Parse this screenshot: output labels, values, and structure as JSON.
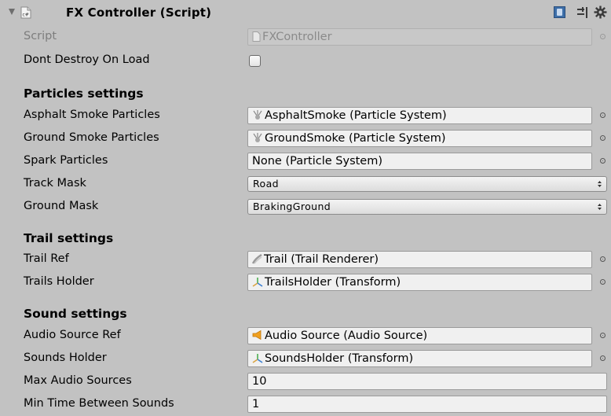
{
  "header": {
    "title": "FX Controller (Script)",
    "script_icon_text": "c#"
  },
  "fields": {
    "script": {
      "label": "Script",
      "value": "FXController"
    },
    "dont_destroy": {
      "label": "Dont Destroy On Load",
      "checked": false
    }
  },
  "particles": {
    "section_title": "Particles settings",
    "asphalt": {
      "label": "Asphalt Smoke Particles",
      "value": "AsphaltSmoke (Particle System)",
      "icon": "particle-system-icon"
    },
    "ground": {
      "label": "Ground Smoke Particles",
      "value": "GroundSmoke (Particle System)",
      "icon": "particle-system-icon"
    },
    "spark": {
      "label": "Spark Particles",
      "value": "None (Particle System)"
    },
    "track_mask": {
      "label": "Track Mask",
      "value": "Road"
    },
    "ground_mask": {
      "label": "Ground Mask",
      "value": "BrakingGround"
    }
  },
  "trail": {
    "section_title": "Trail settings",
    "trail_ref": {
      "label": "Trail Ref",
      "value": "Trail (Trail Renderer)",
      "icon": "trail-renderer-icon"
    },
    "trails_holder": {
      "label": "Trails Holder",
      "value": "TrailsHolder (Transform)",
      "icon": "transform-icon"
    }
  },
  "sound": {
    "section_title": "Sound settings",
    "audio_source_ref": {
      "label": "Audio Source Ref",
      "value": "Audio Source (Audio Source)",
      "icon": "audio-source-icon"
    },
    "sounds_holder": {
      "label": "Sounds Holder",
      "value": "SoundsHolder (Transform)",
      "icon": "transform-icon"
    },
    "max_audio_sources": {
      "label": "Max Audio Sources",
      "value": "10"
    },
    "min_time_between": {
      "label": "Min Time Between Sounds",
      "value": "1"
    }
  },
  "colors": {
    "background": "#c2c2c2",
    "field_bg": "#f0f0f0",
    "disabled_text": "#7d7d7d",
    "help_icon_blue": "#3d6ea8"
  }
}
